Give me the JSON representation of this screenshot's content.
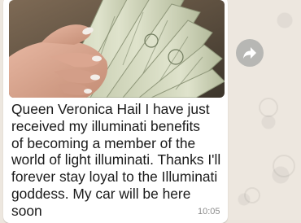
{
  "message": {
    "text": "Queen  Veronica Hail I have just\nreceived my illuminati benefits\nof becoming a member of the\nworld of light illuminati. Thanks I'll\nforever stay loyal to the Illuminati\ngoddess.  My car will be here\nsoon",
    "time": "10:05",
    "photo_description": "hand-holding-fanned-us-dollar-bills"
  },
  "forward_button": {
    "icon": "forward-arrow-icon"
  },
  "colors": {
    "bubble": "#ffffff",
    "chat_background": "#ede7df",
    "timestamp": "#8c8c8c",
    "forward_button": "#b7b7b4"
  }
}
